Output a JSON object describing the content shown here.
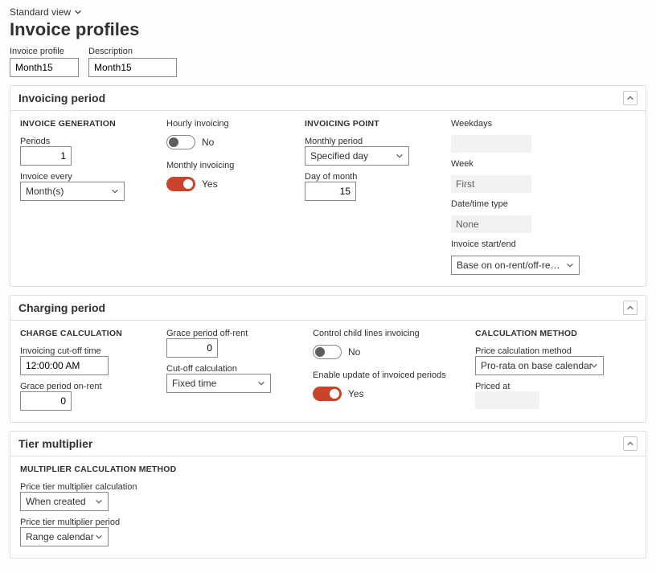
{
  "header": {
    "view_selector": "Standard view",
    "page_title": "Invoice profiles",
    "invoice_profile_label": "Invoice profile",
    "invoice_profile_value": "Month15",
    "description_label": "Description",
    "description_value": "Month15"
  },
  "invoicing_period": {
    "title": "Invoicing period",
    "gen": {
      "heading": "INVOICE GENERATION",
      "periods_label": "Periods",
      "periods_value": "1",
      "invoice_every_label": "Invoice every",
      "invoice_every_value": "Month(s)"
    },
    "toggles": {
      "hourly_label": "Hourly invoicing",
      "hourly_on": false,
      "monthly_label": "Monthly invoicing",
      "monthly_on": true,
      "no_text": "No",
      "yes_text": "Yes"
    },
    "point": {
      "heading": "INVOICING POINT",
      "monthly_period_label": "Monthly period",
      "monthly_period_value": "Specified day",
      "day_of_month_label": "Day of month",
      "day_of_month_value": "15"
    },
    "read": {
      "weekdays_label": "Weekdays",
      "week_label": "Week",
      "week_value": "First",
      "date_time_type_label": "Date/time type",
      "date_time_type_value": "None",
      "invoice_start_end_label": "Invoice start/end",
      "invoice_start_end_value": "Base on on-rent/off-rent dat…"
    }
  },
  "charging_period": {
    "title": "Charging period",
    "charge": {
      "heading": "CHARGE CALCULATION",
      "cutoff_time_label": "Invoicing cut-off time",
      "cutoff_time_value": "12:00:00 AM",
      "grace_on_label": "Grace period on-rent",
      "grace_on_value": "0"
    },
    "mid": {
      "grace_off_label": "Grace period off-rent",
      "grace_off_value": "0",
      "cutoff_calc_label": "Cut-off calculation",
      "cutoff_calc_value": "Fixed time"
    },
    "toggles": {
      "control_child_label": "Control child lines invoicing",
      "control_child_on": false,
      "update_invoiced_label": "Enable update of invoiced periods",
      "update_invoiced_on": true,
      "no_text": "No",
      "yes_text": "Yes"
    },
    "method": {
      "heading": "CALCULATION METHOD",
      "price_calc_label": "Price calculation method",
      "price_calc_value": "Pro-rata on base calendar",
      "priced_at_label": "Priced at",
      "priced_at_value": ""
    }
  },
  "tier": {
    "title": "Tier multiplier",
    "heading": "MULTIPLIER CALCULATION METHOD",
    "calc_label": "Price tier multiplier calculation",
    "calc_value": "When created",
    "period_label": "Price tier multiplier period",
    "period_value": "Range calendar"
  }
}
